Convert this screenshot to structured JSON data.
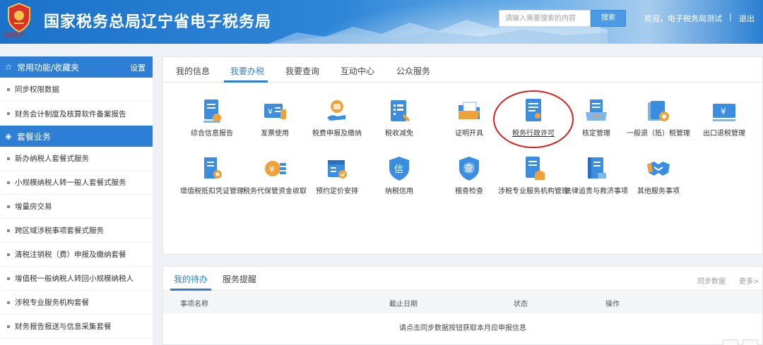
{
  "header": {
    "emblem_caption": "中国税务",
    "title": "国家税务总局辽宁省电子税务局",
    "search_placeholder": "请输入需要搜索的内容",
    "search_button": "搜索",
    "welcome": "欢迎，电子税务局测试",
    "separator": "|",
    "logout": "退出"
  },
  "sidebar": {
    "section1": {
      "title": "常用功能/收藏夹",
      "settings": "设置"
    },
    "favorites": [
      "同步权限数据",
      "财务会计制度及核算软件备案报告"
    ],
    "section2": {
      "title": "套餐业务"
    },
    "packages": [
      "新办纳税人套餐式服务",
      "小规模纳税人转一般人套餐式服务",
      "增量房交易",
      "跨区域涉税事项套餐式服务",
      "清税注销税（费）申报及缴纳套餐",
      "增值税一般纳税人转回小规模纳税人",
      "涉税专业服务机构套餐",
      "财务报告报送与信息采集套餐"
    ]
  },
  "main": {
    "tabs": [
      "我的信息",
      "我要办税",
      "我要查询",
      "互动中心",
      "公众服务"
    ],
    "active_tab": "我要办税",
    "services_row1": [
      {
        "label": "综合信息报告",
        "icon": "doc-pin-icon"
      },
      {
        "label": "发票使用",
        "icon": "invoice-icon"
      },
      {
        "label": "税费申报及缴纳",
        "icon": "coins-hand-icon"
      },
      {
        "label": "税收减免",
        "icon": "list-discount-icon"
      },
      {
        "label": "证明开具",
        "icon": "folder-icon"
      },
      {
        "label": "税务行政许可",
        "icon": "license-doc-icon"
      },
      {
        "label": "核定管理",
        "icon": "tray-doc-icon"
      },
      {
        "label": "一般退（抵）税管理",
        "icon": "cards-gear-icon"
      },
      {
        "label": "出口退税管理",
        "icon": "yen-card-icon"
      }
    ],
    "services_row2": [
      {
        "label": "增值税抵扣凭证管理",
        "icon": "doc-gear-icon"
      },
      {
        "label": "税务代保管资金收取",
        "icon": "coin-stack-icon"
      },
      {
        "label": "预约定价安排",
        "icon": "calendar-check-icon"
      },
      {
        "label": "纳税信用",
        "icon": "credit-shield-icon"
      },
      {
        "label": "稽查检查",
        "icon": "inspect-shield-icon"
      },
      {
        "label": "涉税专业服务机构管理",
        "icon": "doc-building-icon"
      },
      {
        "label": "法律追责与救济事项",
        "icon": "book-icon"
      },
      {
        "label": "其他服务事项",
        "icon": "handshake-icon"
      }
    ]
  },
  "todo": {
    "tabs": [
      "我的待办",
      "服务提醒"
    ],
    "active_tab": "我的待办",
    "sync": "同步数据",
    "more": "更多>",
    "columns": [
      "事项名称",
      "截止日期",
      "状态",
      "操作"
    ],
    "empty_text": "请点击同步数据按钮获取本月应申报信息"
  },
  "colors": {
    "primary": "#2d7fd5",
    "highlight_circle": "#d82020",
    "icon_blue": "#3b8de0",
    "icon_orange": "#f0a23a"
  }
}
